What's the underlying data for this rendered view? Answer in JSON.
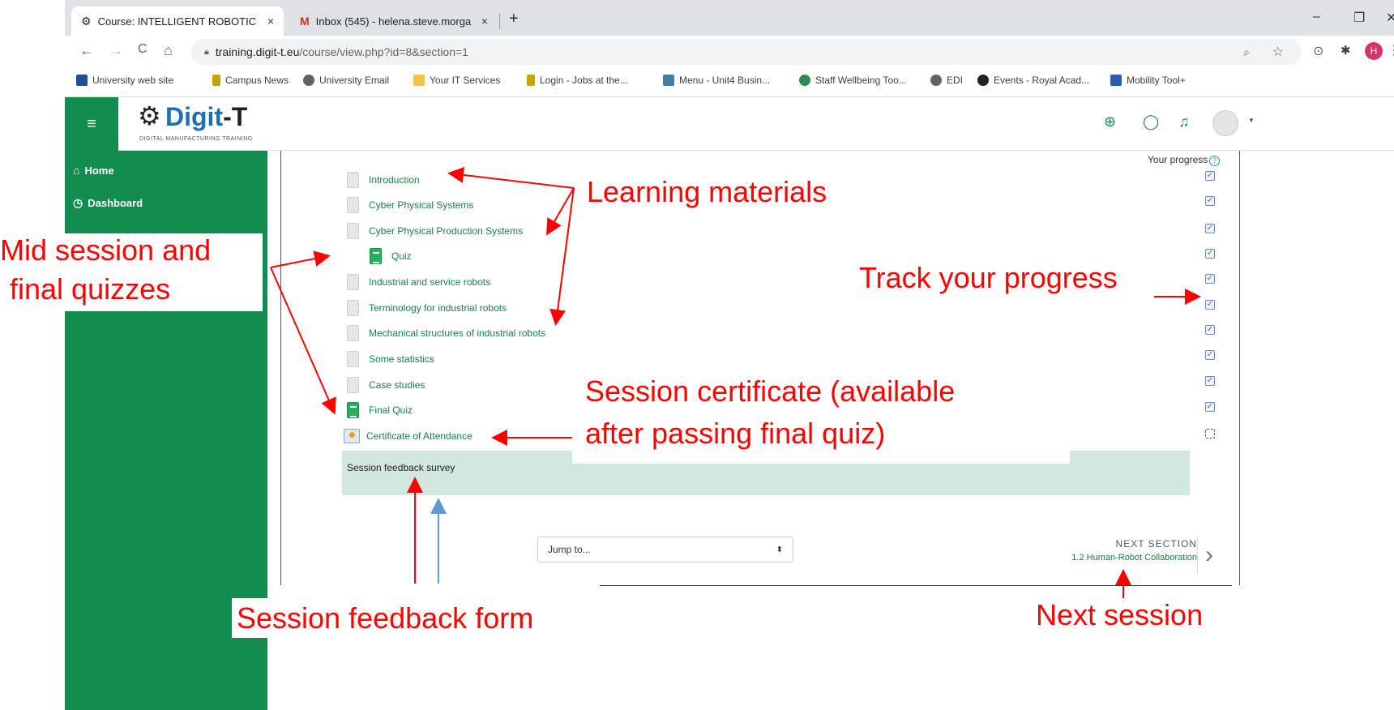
{
  "browser": {
    "tabs": [
      {
        "title": "Course: INTELLIGENT ROBOTICS",
        "close": "×",
        "active": true
      },
      {
        "title": "Inbox (545) - helena.steve.morga",
        "close": "×",
        "active": false
      }
    ],
    "new_tab": "+",
    "window_controls": [
      "–",
      "❐",
      "✕"
    ],
    "nav": {
      "back": "←",
      "forward": "→",
      "reload": "C",
      "home": "⌂"
    },
    "url_host": "training.digit-t.eu",
    "url_path": "/course/view.php?id=8&section=1",
    "bookmarks": [
      {
        "label": "University web site",
        "color": "#1f4e9c"
      },
      {
        "label": "Campus News",
        "color": "#caa300"
      },
      {
        "label": "University Email",
        "color": "#5f6368"
      },
      {
        "label": "Your IT Services",
        "color": "#f6c344"
      },
      {
        "label": "Login - Jobs at the...",
        "color": "#caa300"
      },
      {
        "label": "Menu - Unit4 Busin...",
        "color": "#3f7fa6"
      },
      {
        "label": "Staff Wellbeing Too...",
        "color": "#2e8b57"
      },
      {
        "label": "EDI",
        "color": "#5f6368"
      },
      {
        "label": "Events - Royal Acad...",
        "color": "#222222"
      },
      {
        "label": "Mobility Tool+",
        "color": "#2a5db0"
      }
    ],
    "avatar_letter": "H"
  },
  "site": {
    "logo_main": "Digit",
    "logo_suffix": "-T",
    "logo_subtitle": "DIGITAL MANUFACTURING TRAINING",
    "menu_icon": "≡",
    "sidebar": [
      {
        "label": "Home",
        "icon": "⌂"
      },
      {
        "label": "Dashboard",
        "icon": "◷"
      }
    ]
  },
  "course": {
    "activities": [
      {
        "label": "Introduction",
        "type": "file"
      },
      {
        "label": "Cyber Physical Systems",
        "type": "file"
      },
      {
        "label": "Cyber Physical Production Systems",
        "type": "file"
      },
      {
        "label": "Quiz",
        "type": "quiz"
      },
      {
        "label": "Industrial and service robots",
        "type": "file"
      },
      {
        "label": "Terminology for industrial robots",
        "type": "file"
      },
      {
        "label": "Mechanical structures of industrial robots",
        "type": "file"
      },
      {
        "label": "Some statistics",
        "type": "file"
      },
      {
        "label": "Case studies",
        "type": "file"
      },
      {
        "label": "Final Quiz",
        "type": "quiz"
      },
      {
        "label": "Certificate of Attendance",
        "type": "certificate"
      }
    ],
    "feedback_label": "Session feedback survey",
    "progress_label": "Your progress",
    "progress_help": "?",
    "completion": [
      true,
      true,
      true,
      true,
      true,
      true,
      true,
      true,
      true,
      true,
      false
    ],
    "check_mark": "✓",
    "jump_placeholder": "Jump to...",
    "jump_caret": "⬍",
    "next_kicker": "NEXT SECTION",
    "next_link": "1.2 Human-Robot Collaboration",
    "next_chevron": "›"
  },
  "annotations": {
    "learning_materials": "Learning materials",
    "mid_final_quizzes_line1": "Mid session and",
    "mid_final_quizzes_line2": "final quizzes",
    "track_progress": "Track your progress",
    "certificate_line1": "Session certificate (available",
    "certificate_line2": "after passing final quiz)",
    "feedback_form": "Session feedback form",
    "next_session": "Next session",
    "arrow_color": "#ff0000",
    "pointer_color": "#5b9bd5"
  }
}
